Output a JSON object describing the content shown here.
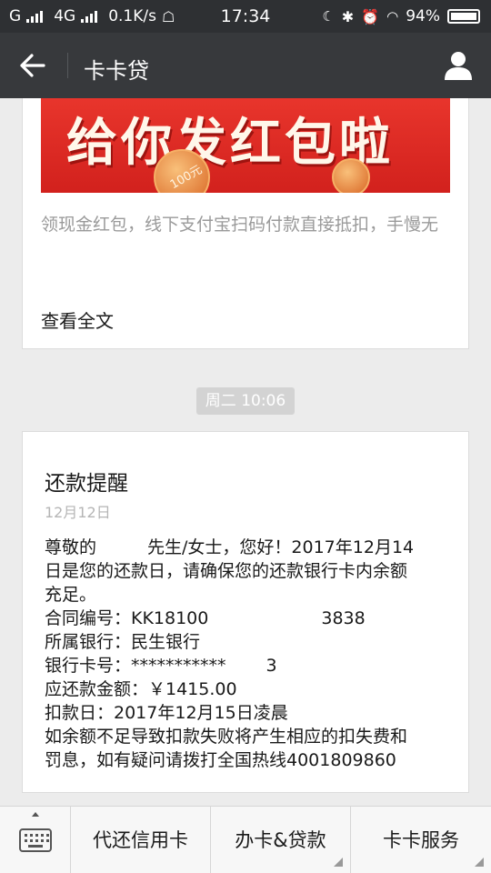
{
  "status_bar": {
    "carrier1": "G",
    "carrier2": "4G",
    "speed": "0.1K/s",
    "time": "17:34",
    "battery": "94%"
  },
  "nav": {
    "title": "卡卡贷",
    "back_icon": "arrow-left-icon",
    "user_icon": "person-icon"
  },
  "card1": {
    "banner_text": "给你发红包啦",
    "coin_label": "100元",
    "desc": "领现金红包，线下支付宝扫码付款直接抵扣，手慢无",
    "read_more": "查看全文"
  },
  "timestamp": "周二 10:06",
  "card2": {
    "title": "还款提醒",
    "date": "12月12日",
    "lines": {
      "l1a": "尊敬的",
      "l1b": "先生/女士，您好！2017年12月14",
      "l2": "日是您的还款日，请确保您的还款银行卡内余额",
      "l3": "充足。",
      "l4a": "合同编号：KK18100",
      "l4b": "3838",
      "l5": "所属银行：民生银行",
      "l6a": "银行卡号：***********",
      "l6b": "3",
      "l7": "应还款金额：￥1415.00",
      "l8": "扣款日：2017年12月15日凌晨",
      "l9": "如余额不足导致扣款失败将产生相应的扣失费和",
      "l10": "罚息，如有疑问请拨打全国热线4001809860"
    }
  },
  "bottom_menu": {
    "keyboard_icon": "keyboard-icon",
    "items": [
      "代还信用卡",
      "办卡&贷款",
      "卡卡服务"
    ]
  },
  "colors": {
    "nav_bg": "#37393c",
    "status_bg": "#2e3033",
    "banner_red": "#d2211d",
    "page_bg": "#ececec"
  }
}
